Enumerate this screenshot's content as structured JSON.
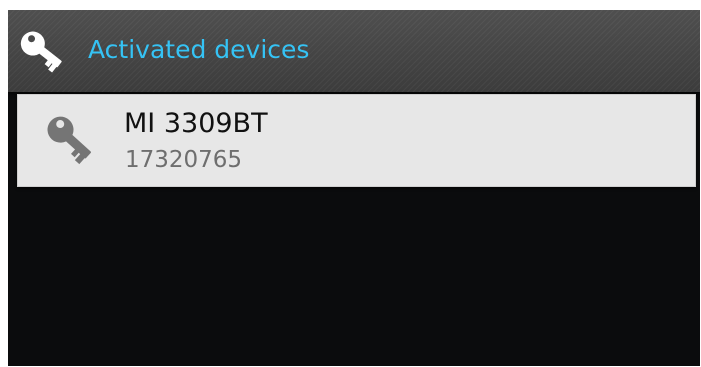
{
  "app_bar": {
    "title": "Activated devices",
    "icon": "key-icon",
    "title_color": "#35c3f5"
  },
  "devices": [
    {
      "name": "MI 3309BT",
      "serial": "17320765",
      "icon": "key-icon"
    }
  ]
}
